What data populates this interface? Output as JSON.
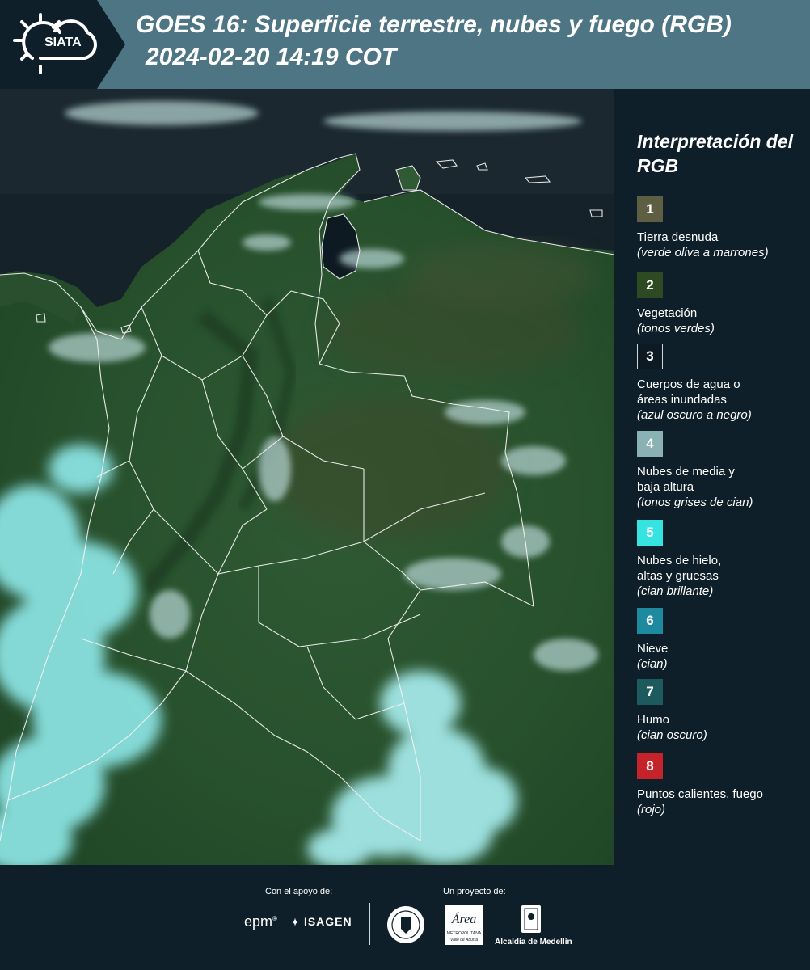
{
  "header": {
    "logo_text": "SIATA",
    "title_line1": "GOES 16: Superficie terrestre, nubes y fuego (RGB)",
    "title_line2": "2024-02-20 14:19 COT"
  },
  "legend": {
    "title": "Interpretación del RGB",
    "items": [
      {
        "number": "1",
        "name": "Tierra desnuda",
        "desc": "(verde oliva a marrones)",
        "color": "#5e5e43"
      },
      {
        "number": "2",
        "name": "Vegetación",
        "desc": "(tonos verdes)",
        "color": "#2e4a23"
      },
      {
        "number": "3",
        "name": "Cuerpos de agua o\náreas inundadas",
        "desc": "(azul oscuro a negro)",
        "color": "#0d1a24"
      },
      {
        "number": "4",
        "name": "Nubes de media y\nbaja altura",
        "desc": "(tonos grises de cian)",
        "color": "#8ab1b3"
      },
      {
        "number": "5",
        "name": "Nubes de hielo,\naltas y gruesas",
        "desc": "(cian brillante)",
        "color": "#35e3e0"
      },
      {
        "number": "6",
        "name": "Nieve",
        "desc": "(cian)",
        "color": "#1e8aa0"
      },
      {
        "number": "7",
        "name": "Humo",
        "desc": "(cian oscuro)",
        "color": "#1c5a5e"
      },
      {
        "number": "8",
        "name": "Puntos calientes, fuego",
        "desc": "(rojo)",
        "color": "#c4232a"
      }
    ]
  },
  "footer": {
    "support_label": "Con el apoyo de:",
    "project_label": "Un proyecto de:",
    "sponsors": [
      "epm",
      "ISAGEN"
    ],
    "partners": {
      "area_name": "Área",
      "area_caption": "METROPOLITANA",
      "area_subcaption": "Valle de Aburrá",
      "alcaldia": "Alcaldía de Medellín"
    }
  }
}
